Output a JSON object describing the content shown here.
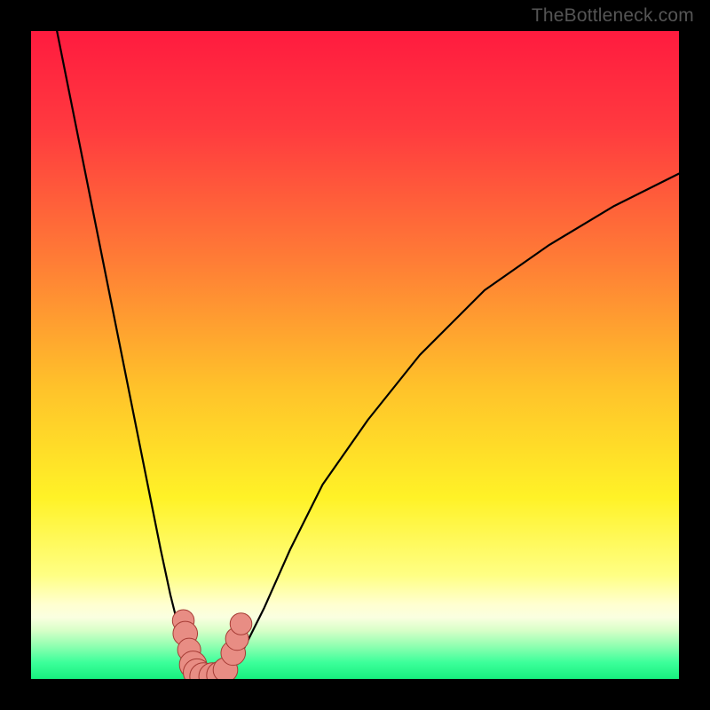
{
  "watermark": "TheBottleneck.com",
  "chart_data": {
    "type": "line",
    "title": "",
    "xlabel": "",
    "ylabel": "",
    "xlim": [
      0,
      100
    ],
    "ylim": [
      0,
      100
    ],
    "grid": false,
    "legend": false,
    "gradient_stops": [
      {
        "offset": 0.0,
        "color": "#ff1b3f"
      },
      {
        "offset": 0.15,
        "color": "#ff3a3f"
      },
      {
        "offset": 0.35,
        "color": "#ff7b36"
      },
      {
        "offset": 0.55,
        "color": "#ffc22a"
      },
      {
        "offset": 0.72,
        "color": "#fff227"
      },
      {
        "offset": 0.84,
        "color": "#ffff84"
      },
      {
        "offset": 0.885,
        "color": "#ffffd0"
      },
      {
        "offset": 0.905,
        "color": "#faffe0"
      },
      {
        "offset": 0.925,
        "color": "#d8ffc8"
      },
      {
        "offset": 0.95,
        "color": "#8dffb0"
      },
      {
        "offset": 0.975,
        "color": "#3bff9a"
      },
      {
        "offset": 1.0,
        "color": "#17f07e"
      }
    ],
    "series": [
      {
        "name": "left-branch",
        "x": [
          4,
          6,
          8,
          10,
          12,
          14,
          16,
          18,
          20,
          21.5,
          23,
          24.5,
          25.5
        ],
        "y": [
          100,
          90,
          80,
          70,
          60,
          50,
          40,
          30,
          20,
          13,
          7,
          2,
          0
        ]
      },
      {
        "name": "right-branch",
        "x": [
          30,
          31.5,
          33.5,
          36,
          40,
          45,
          52,
          60,
          70,
          80,
          90,
          100
        ],
        "y": [
          0,
          2,
          6,
          11,
          20,
          30,
          40,
          50,
          60,
          67,
          73,
          78
        ]
      },
      {
        "name": "valley-floor",
        "x": [
          25.5,
          27,
          28.5,
          30
        ],
        "y": [
          0,
          0.2,
          0.2,
          0
        ]
      }
    ],
    "markers": [
      {
        "x": 23.5,
        "y": 9.0,
        "r": 1.6
      },
      {
        "x": 23.8,
        "y": 7.0,
        "r": 1.8
      },
      {
        "x": 24.4,
        "y": 4.5,
        "r": 1.7
      },
      {
        "x": 25.0,
        "y": 2.2,
        "r": 2.0
      },
      {
        "x": 25.6,
        "y": 1.0,
        "r": 2.0
      },
      {
        "x": 26.6,
        "y": 0.4,
        "r": 2.0
      },
      {
        "x": 28.0,
        "y": 0.4,
        "r": 2.0
      },
      {
        "x": 29.2,
        "y": 0.6,
        "r": 2.0
      },
      {
        "x": 30.0,
        "y": 1.4,
        "r": 1.8
      },
      {
        "x": 31.2,
        "y": 4.0,
        "r": 1.8
      },
      {
        "x": 31.8,
        "y": 6.2,
        "r": 1.7
      },
      {
        "x": 32.4,
        "y": 8.5,
        "r": 1.6
      }
    ],
    "marker_style": {
      "fill": "#e88d84",
      "stroke": "#a63c35",
      "stroke_width": 1.0
    }
  }
}
